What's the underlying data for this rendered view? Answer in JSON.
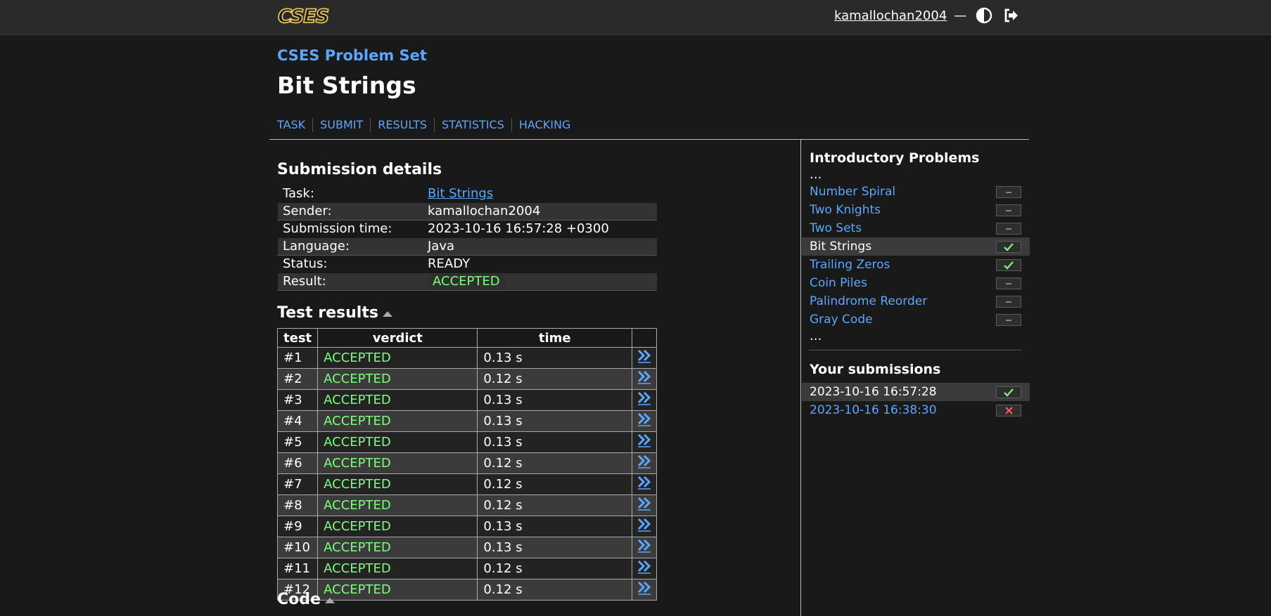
{
  "header": {
    "logo_text": "CSES",
    "username": "kamallochan2004",
    "separator": "—",
    "theme_icon": "contrast-icon",
    "logout_icon": "logout-icon"
  },
  "page": {
    "problemset": "CSES Problem Set",
    "title": "Bit Strings",
    "tabs": [
      "TASK",
      "SUBMIT",
      "RESULTS",
      "STATISTICS",
      "HACKING"
    ]
  },
  "submission": {
    "heading": "Submission details",
    "rows": [
      {
        "key": "Task:",
        "value": "Bit Strings"
      },
      {
        "key": "Sender:",
        "value": "kamallochan2004"
      },
      {
        "key": "Submission time:",
        "value": "2023-10-16 16:57:28 +0300"
      },
      {
        "key": "Language:",
        "value": "Java"
      },
      {
        "key": "Status:",
        "value": "READY"
      },
      {
        "key": "Result:",
        "value": "ACCEPTED"
      }
    ]
  },
  "tests": {
    "heading": "Test results",
    "columns": [
      "test",
      "verdict",
      "time",
      ""
    ],
    "rows": [
      {
        "test": "#1",
        "verdict": "ACCEPTED",
        "time": "0.13 s"
      },
      {
        "test": "#2",
        "verdict": "ACCEPTED",
        "time": "0.12 s"
      },
      {
        "test": "#3",
        "verdict": "ACCEPTED",
        "time": "0.13 s"
      },
      {
        "test": "#4",
        "verdict": "ACCEPTED",
        "time": "0.13 s"
      },
      {
        "test": "#5",
        "verdict": "ACCEPTED",
        "time": "0.13 s"
      },
      {
        "test": "#6",
        "verdict": "ACCEPTED",
        "time": "0.12 s"
      },
      {
        "test": "#7",
        "verdict": "ACCEPTED",
        "time": "0.12 s"
      },
      {
        "test": "#8",
        "verdict": "ACCEPTED",
        "time": "0.12 s"
      },
      {
        "test": "#9",
        "verdict": "ACCEPTED",
        "time": "0.13 s"
      },
      {
        "test": "#10",
        "verdict": "ACCEPTED",
        "time": "0.13 s"
      },
      {
        "test": "#11",
        "verdict": "ACCEPTED",
        "time": "0.12 s"
      },
      {
        "test": "#12",
        "verdict": "ACCEPTED",
        "time": "0.12 s"
      }
    ]
  },
  "code": {
    "heading": "Code"
  },
  "sidebar": {
    "section_title": "Introductory Problems",
    "ellipsis": "...",
    "problems": [
      {
        "name": "Number Spiral",
        "status": "none",
        "current": false
      },
      {
        "name": "Two Knights",
        "status": "none",
        "current": false
      },
      {
        "name": "Two Sets",
        "status": "none",
        "current": false
      },
      {
        "name": "Bit Strings",
        "status": "solved",
        "current": true
      },
      {
        "name": "Trailing Zeros",
        "status": "solved",
        "current": false
      },
      {
        "name": "Coin Piles",
        "status": "none",
        "current": false
      },
      {
        "name": "Palindrome Reorder",
        "status": "none",
        "current": false
      },
      {
        "name": "Gray Code",
        "status": "none",
        "current": false
      }
    ],
    "submissions_title": "Your submissions",
    "submissions": [
      {
        "time": "2023-10-16 16:57:28",
        "status": "solved",
        "current": true
      },
      {
        "time": "2023-10-16 16:38:30",
        "status": "failed",
        "current": false
      }
    ]
  },
  "colors": {
    "background": "#191919",
    "header": "#2a2a2a",
    "link": "#5da6ff",
    "accepted": "#7cff7c",
    "failed": "#ff5c5c",
    "logo": "#e8c35a"
  }
}
